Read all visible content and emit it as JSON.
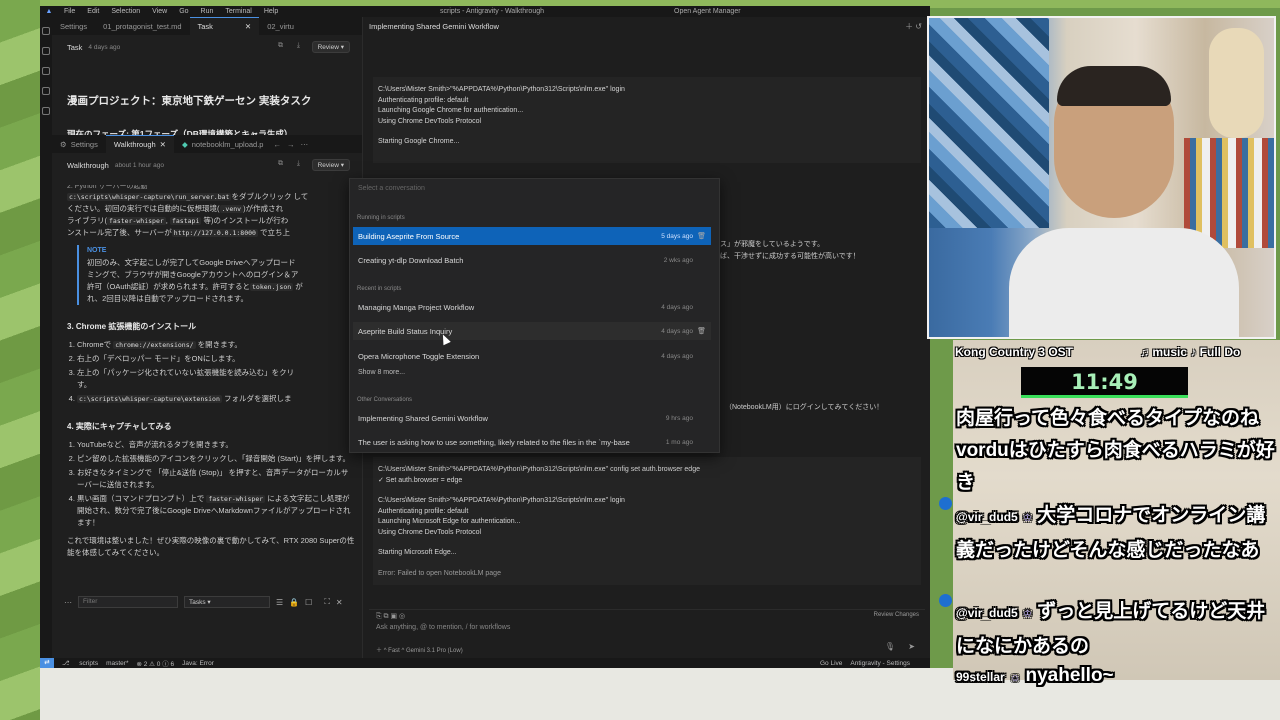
{
  "ide": {
    "menu": [
      "File",
      "Edit",
      "Selection",
      "View",
      "Go",
      "Run",
      "Terminal",
      "Help"
    ],
    "window_title": "scripts - Antigravity - Walkthrough",
    "agent_manager": "Open Agent Manager",
    "top_tabs": [
      "Settings",
      "01_protagonist_test.md",
      "Task",
      "02_virtu"
    ],
    "task_head": {
      "label": "Task",
      "ago": "4 days ago",
      "review": "Review"
    },
    "task_title": "漫画プロジェクト：東京地下鉄ゲーセン 実装タスク",
    "task_phase": "現在のフェーズ: 第1フェーズ（DB環境構築とキャラ生成）",
    "mid_tabs": [
      "Settings",
      "Walkthrough",
      "notebooklm_upload.p"
    ],
    "walk_head": {
      "label": "Walkthrough",
      "ago": "about 1 hour ago",
      "review": "Review"
    },
    "walkthrough": {
      "top_cut": "2. Python サーバーの起動",
      "p1_code": "c:\\scripts\\whisper-capture\\run_server.bat",
      "p1_a": "をダブルクリック して",
      "p1_b": "ください。初回の実行では自動的に仮想環境(",
      "p1_venv": ".venv",
      "p1_c": ")が作成され",
      "p1_d": "ライブラリ(",
      "p1_fw": "faster-whisper",
      "p1_sep": ", ",
      "p1_fa": "fastapi",
      "p1_e": " 等)のインストールが行わ",
      "p1_f": "ンストール完了後、サーバーが",
      "p1_url": "http://127.0.0.1:8000",
      "p1_g": " で立ち上",
      "note_title": "NOTE",
      "note_a": "初回のみ、文字起こしが完了してGoogle Driveへアップロード",
      "note_b": "ミングで、ブラウザが開きGoogleアカウントへのログイン＆ア",
      "note_c": "許可（OAuth認証）が求められます。許可すると",
      "note_code": "token.json",
      "note_d": " が",
      "note_e": "れ、2回目以降は自動でアップロードされます。",
      "s3": "3. Chrome 拡張機能のインストール",
      "s3_1a": "Chromeで ",
      "s3_1code": "chrome://extensions/",
      "s3_1b": " を開きます。",
      "s3_2": "右上の「デベロッパー モード」をONにします。",
      "s3_3": "左上の「パッケージ化されていない拡張機能を読み込む」をクリ",
      "s3_3b": "す。",
      "s3_4code": "c:\\scripts\\whisper-capture\\extension",
      "s3_4": " フォルダを選択しま",
      "s4": "4. 実際にキャプチャしてみる",
      "s4_1": "YouTubeなど、音声が流れるタブを開きます。",
      "s4_2": "ピン留めした拡張機能のアイコンをクリックし、「録音開始 (Start)」を押します。",
      "s4_3": "お好きなタイミングで 「停止&送信 (Stop)」 を押すと、音声データがローカルサーバーに送信されます。",
      "s4_4a": "黒い画面（コマンドプロンプト）上で ",
      "s4_4code": "faster-whisper",
      "s4_4b": " による文字起こし処理が開始され、数分で完了後にGoogle DriveへMarkdownファイルがアップロードされます！",
      "closing": "これで環境は整いました！ぜひ実際の映像の裏で動かしてみて、RTX 2080 Superの性能を体感してみてください。"
    },
    "filter": {
      "placeholder": "Filter",
      "tasks": "Tasks"
    },
    "status": {
      "branch": "scripts",
      "git": "master*",
      "problems": "⊗ 2 ⚠ 0 ⓘ 6",
      "java": "Java: Error",
      "golive": "Go Live",
      "ag": "Antigravity - Settings"
    }
  },
  "agent": {
    "title": "Implementing Shared Gemini Workflow",
    "term1": [
      "C:\\Users\\Mister Smith>\"%APPDATA%\\Python\\Python312\\Scripts\\nlm.exe\" login",
      "Authenticating profile: default",
      "Launching Google Chrome for authentication...",
      "Using Chrome DevTools Protocol",
      "",
      "Starting Google Chrome..."
    ],
    "jp1": "ス」が邪魔をしているようです。",
    "jp2": "ば、干渉せずに成功する可能性が高いです！",
    "jp3": "（NotebookLM用）にログインしてみてください！",
    "term2": [
      "C:\\Users\\Mister Smith>\"%APPDATA%\\Python\\Python312\\Scripts\\nlm.exe\" config set auth.browser edge",
      "✓ Set auth.browser = edge",
      "",
      "C:\\Users\\Mister Smith>\"%APPDATA%\\Python\\Python312\\Scripts\\nlm.exe\" login",
      "Authenticating profile: default",
      "Launching Microsoft Edge for authentication...",
      "Using Chrome DevTools Protocol",
      "",
      "Starting Microsoft Edge...",
      "",
      "Error: Failed to open NotebookLM page"
    ],
    "review_changes": "Review Changes",
    "input_placeholder": "Ask anything, @ to mention, / for workflows",
    "mode": "Fast",
    "model": "Gemini 3.1 Pro (Low)"
  },
  "dropdown": {
    "search_placeholder": "Select a conversation",
    "sec_running": "Running in scripts",
    "sec_recent": "Recent in scripts",
    "sec_other": "Other Conversations",
    "running": [
      {
        "title": "Building Aseprite From Source",
        "time": "5 days ago"
      },
      {
        "title": "Creating yt-dlp Download Batch",
        "time": "2 wks ago"
      }
    ],
    "recent": [
      {
        "title": "Managing Manga Project Workflow",
        "time": "4 days ago"
      },
      {
        "title": "Aseprite Build Status Inquiry",
        "time": "4 days ago"
      },
      {
        "title": "Opera Microphone Toggle Extension",
        "time": "4 days ago"
      }
    ],
    "show_more": "Show 8 more...",
    "other": [
      {
        "title": "Implementing Shared Gemini Workflow",
        "time": "9 hrs ago"
      },
      {
        "title": "The user is asking how to use something, likely related to the files in the `my-base",
        "time": "1 mo ago"
      }
    ]
  },
  "stream": {
    "song_left": "Kong Country 3 OST",
    "song_right": "♫ music ♪ Full Do",
    "timer": "11:49",
    "chat": [
      {
        "user": "",
        "text": "肉屋行って色々食べるタイプなのね　vorduはひたすら肉食べるハラミが好き"
      },
      {
        "user": "@vir_dud5",
        "badge": "♔",
        "text": "大学コロナでオンライン講義だったけどそんな感じだったなあ"
      },
      {
        "user": "@vir_dud5",
        "badge": "♔",
        "text": "ずっと見上げてるけど天井になにかあるの"
      },
      {
        "user": "99stellar",
        "badge": "☺",
        "text": "nyahello~"
      }
    ]
  }
}
